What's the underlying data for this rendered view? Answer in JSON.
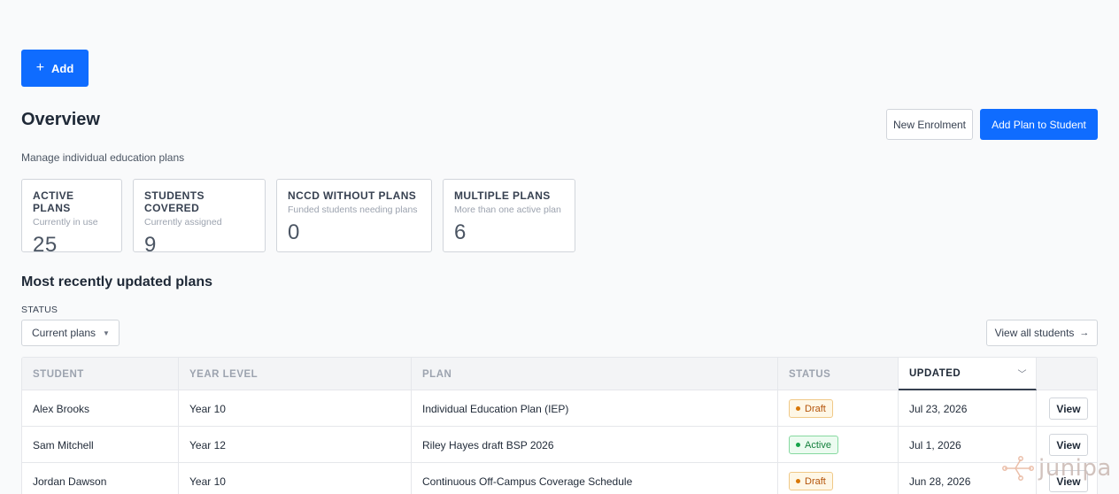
{
  "toolbar": {
    "add_label": "Add"
  },
  "header": {
    "title": "Overview",
    "subtitle": "Manage individual education plans",
    "new_enrolment_label": "New Enrolment",
    "add_plan_label": "Add Plan to Student"
  },
  "stats": [
    {
      "label": "ACTIVE PLANS",
      "sub": "Currently in use",
      "value": "25"
    },
    {
      "label": "STUDENTS COVERED",
      "sub": "Currently assigned",
      "value": "9"
    },
    {
      "label": "NCCD WITHOUT PLANS",
      "sub": "Funded students needing plans",
      "value": "0"
    },
    {
      "label": "MULTIPLE PLANS",
      "sub": "More than one active plan",
      "value": "6"
    }
  ],
  "recent": {
    "title": "Most recently updated plans",
    "status_label": "STATUS",
    "status_value": "Current plans",
    "view_all_label": "View all students",
    "columns": [
      "STUDENT",
      "YEAR LEVEL",
      "PLAN",
      "STATUS",
      "UPDATED"
    ],
    "rows": [
      {
        "student": "Alex Brooks",
        "year": "Year 10",
        "plan": "Individual Education Plan (IEP)",
        "status": "Draft",
        "updated": "Jul 23, 2026",
        "action": "View"
      },
      {
        "student": "Sam Mitchell",
        "year": "Year 12",
        "plan": "Riley Hayes draft BSP 2026",
        "status": "Active",
        "updated": "Jul 1, 2026",
        "action": "View"
      },
      {
        "student": "Jordan Dawson",
        "year": "Year 10",
        "plan": "Continuous Off-Campus Coverage Schedule",
        "status": "Draft",
        "updated": "Jun 28, 2026",
        "action": "View"
      }
    ]
  },
  "watermark": {
    "text": "junipa"
  },
  "colors": {
    "primary": "#0f6cff",
    "draft": "#d97706",
    "active": "#16a34a"
  }
}
